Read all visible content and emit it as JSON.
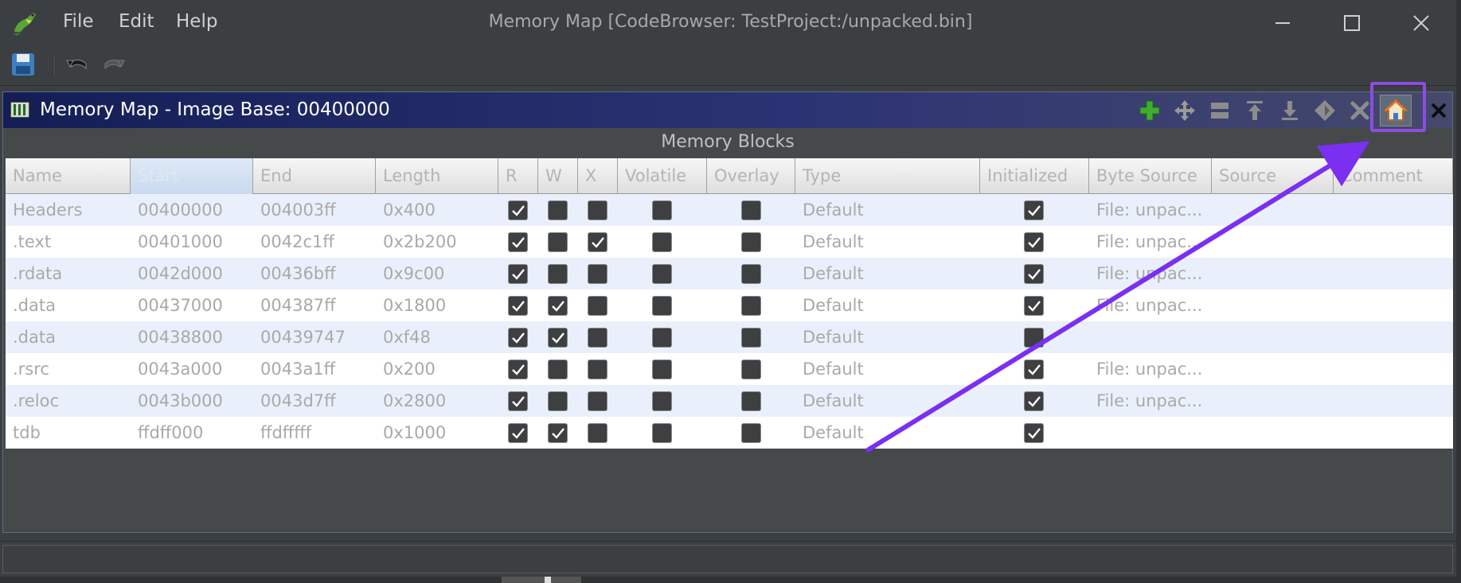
{
  "window": {
    "title": "Memory Map [CodeBrowser: TestProject:/unpacked.bin]",
    "menu": [
      "File",
      "Edit",
      "Help"
    ],
    "controls": [
      "minimize-icon",
      "maximize-icon",
      "close-icon"
    ]
  },
  "toolbar": {
    "buttons": [
      "save-icon",
      "undo-icon",
      "redo-icon"
    ]
  },
  "panel": {
    "title": "Memory Map - Image Base: 00400000",
    "header_buttons": [
      "add-block-icon",
      "move-block-icon",
      "split-block-icon",
      "expand-up-icon",
      "expand-down-icon",
      "merge-blocks-icon",
      "delete-block-icon",
      "set-image-base-icon",
      "close-panel-icon"
    ],
    "highlight_color": "#8c4de0",
    "table_caption": "Memory Blocks"
  },
  "table": {
    "columns": [
      "Name",
      "Start",
      "End",
      "Length",
      "R",
      "W",
      "X",
      "Volatile",
      "Overlay",
      "Type",
      "Initialized",
      "Byte Source",
      "Source",
      "Comment"
    ],
    "sorted_column": "Start",
    "rows": [
      {
        "name": "Headers",
        "start": "00400000",
        "end": "004003ff",
        "length": "0x400",
        "r": true,
        "w": false,
        "x": false,
        "volatile": false,
        "overlay": false,
        "type": "Default",
        "initialized": true,
        "byte_source": "File: unpac...",
        "source": "",
        "comment": ""
      },
      {
        "name": ".text",
        "start": "00401000",
        "end": "0042c1ff",
        "length": "0x2b200",
        "r": true,
        "w": false,
        "x": true,
        "volatile": false,
        "overlay": false,
        "type": "Default",
        "initialized": true,
        "byte_source": "File: unpac...",
        "source": "",
        "comment": ""
      },
      {
        "name": ".rdata",
        "start": "0042d000",
        "end": "00436bff",
        "length": "0x9c00",
        "r": true,
        "w": false,
        "x": false,
        "volatile": false,
        "overlay": false,
        "type": "Default",
        "initialized": true,
        "byte_source": "File: unpac...",
        "source": "",
        "comment": ""
      },
      {
        "name": ".data",
        "start": "00437000",
        "end": "004387ff",
        "length": "0x1800",
        "r": true,
        "w": true,
        "x": false,
        "volatile": false,
        "overlay": false,
        "type": "Default",
        "initialized": true,
        "byte_source": "File: unpac...",
        "source": "",
        "comment": ""
      },
      {
        "name": ".data",
        "start": "00438800",
        "end": "00439747",
        "length": "0xf48",
        "r": true,
        "w": true,
        "x": false,
        "volatile": false,
        "overlay": false,
        "type": "Default",
        "initialized": false,
        "byte_source": "",
        "source": "",
        "comment": ""
      },
      {
        "name": ".rsrc",
        "start": "0043a000",
        "end": "0043a1ff",
        "length": "0x200",
        "r": true,
        "w": false,
        "x": false,
        "volatile": false,
        "overlay": false,
        "type": "Default",
        "initialized": true,
        "byte_source": "File: unpac...",
        "source": "",
        "comment": ""
      },
      {
        "name": ".reloc",
        "start": "0043b000",
        "end": "0043d7ff",
        "length": "0x2800",
        "r": true,
        "w": false,
        "x": false,
        "volatile": false,
        "overlay": false,
        "type": "Default",
        "initialized": true,
        "byte_source": "File: unpac...",
        "source": "",
        "comment": ""
      },
      {
        "name": "tdb",
        "start": "ffdff000",
        "end": "ffdfffff",
        "length": "0x1000",
        "r": true,
        "w": true,
        "x": false,
        "volatile": false,
        "overlay": false,
        "type": "Default",
        "initialized": true,
        "byte_source": "",
        "source": "",
        "comment": ""
      }
    ]
  },
  "annotation": {
    "arrow_color": "#7b2ff0"
  }
}
